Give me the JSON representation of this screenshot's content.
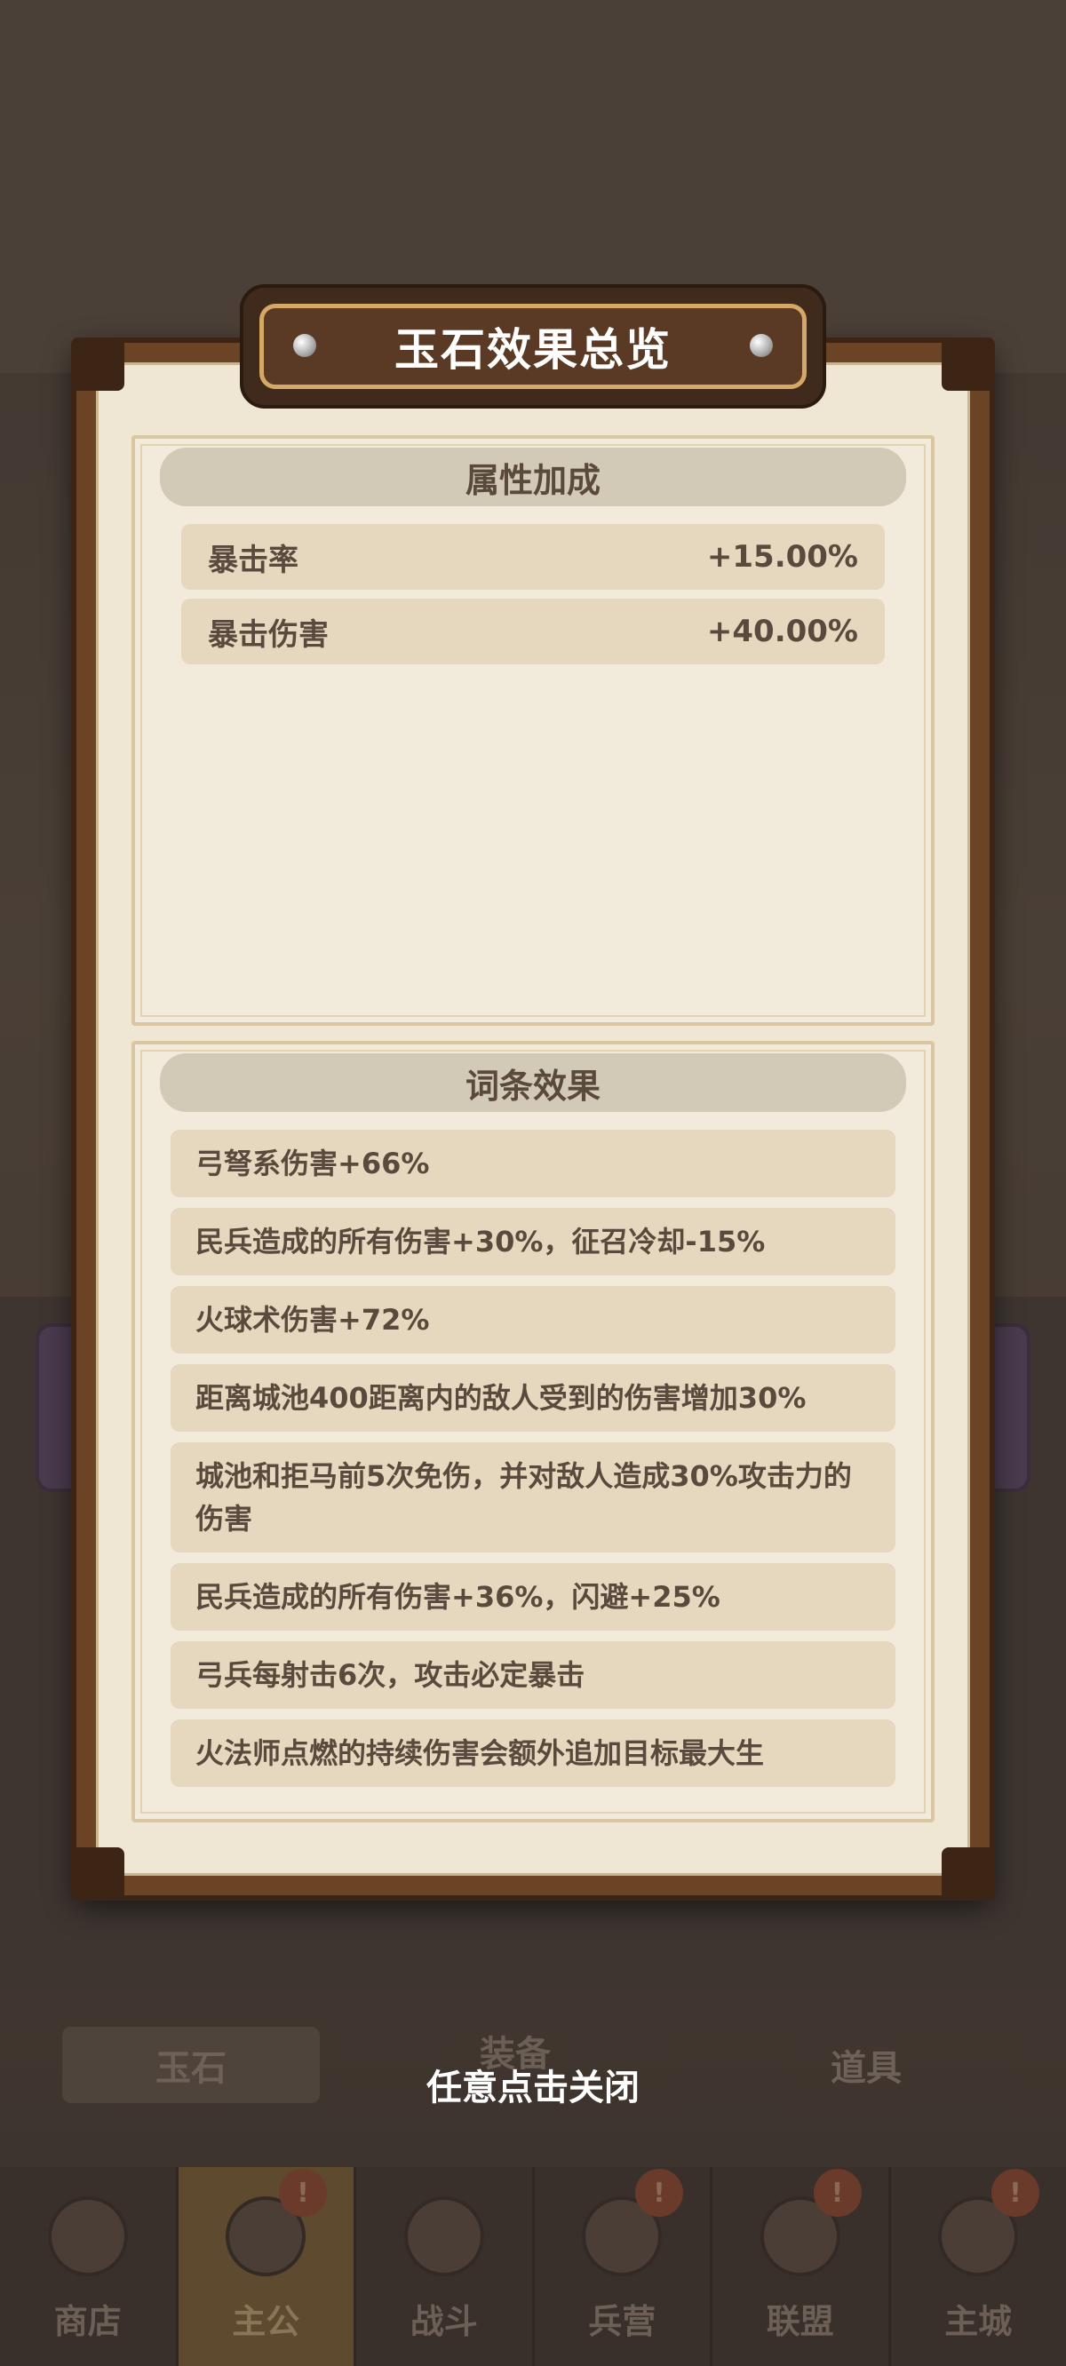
{
  "modal": {
    "title": "玉石效果总览",
    "attributes": {
      "header": "属性加成",
      "rows": [
        {
          "name": "暴击率",
          "value": "+15.00%"
        },
        {
          "name": "暴击伤害",
          "value": "+40.00%"
        }
      ]
    },
    "effects": {
      "header": "词条效果",
      "items": [
        "弓弩系伤害+66%",
        "民兵造成的所有伤害+30%，征召冷却-15%",
        "火球术伤害+72%",
        "距离城池400距离内的敌人受到的伤害增加30%",
        "城池和拒马前5次免伤，并对敌人造成30%攻击力的伤害",
        "民兵造成的所有伤害+36%，闪避+25%",
        "弓兵每射击6次，攻击必定暴击",
        "火法师点燃的持续伤害会额外追加目标最大生"
      ]
    },
    "close_hint": "任意点击关闭"
  },
  "background": {
    "bottom_buttons": [
      "玉石",
      "装备",
      "道具"
    ],
    "tabs": [
      {
        "label": "商店",
        "icon": "shop-icon",
        "badge": ""
      },
      {
        "label": "主公",
        "icon": "lord-icon",
        "badge": "!"
      },
      {
        "label": "战斗",
        "icon": "battle-icon",
        "badge": ""
      },
      {
        "label": "兵营",
        "icon": "barracks-icon",
        "badge": "!"
      },
      {
        "label": "联盟",
        "icon": "alliance-icon",
        "badge": "!"
      },
      {
        "label": "主城",
        "icon": "castle-icon",
        "badge": "!"
      }
    ]
  }
}
